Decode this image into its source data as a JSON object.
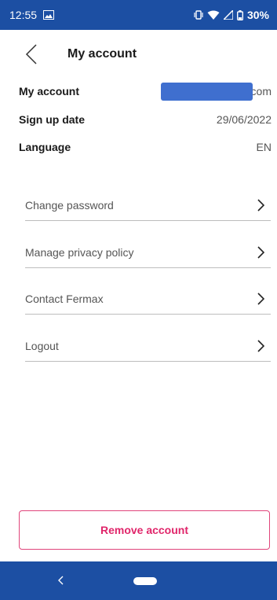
{
  "status_bar": {
    "time": "12:55",
    "battery": "30%"
  },
  "header": {
    "title": "My account"
  },
  "account_info": [
    {
      "label": "My account",
      "value": "com"
    },
    {
      "label": "Sign up date",
      "value": "29/06/2022"
    },
    {
      "label": "Language",
      "value": "EN"
    }
  ],
  "menu": [
    {
      "label": "Change password"
    },
    {
      "label": "Manage privacy policy"
    },
    {
      "label": "Contact Fermax"
    },
    {
      "label": "Logout"
    }
  ],
  "remove_account": {
    "label": "Remove account"
  },
  "colors": {
    "primary": "#1c4fa3",
    "danger": "#e0256a",
    "redaction": "#3f6fcf"
  },
  "icons": {
    "status": [
      "image-icon",
      "vibrate-icon",
      "wifi-icon",
      "signal-icon",
      "battery-icon"
    ],
    "header": "back-arrow-icon",
    "menu": "chevron-right-icon",
    "nav": [
      "nav-back-icon",
      "home-pill-icon"
    ]
  }
}
